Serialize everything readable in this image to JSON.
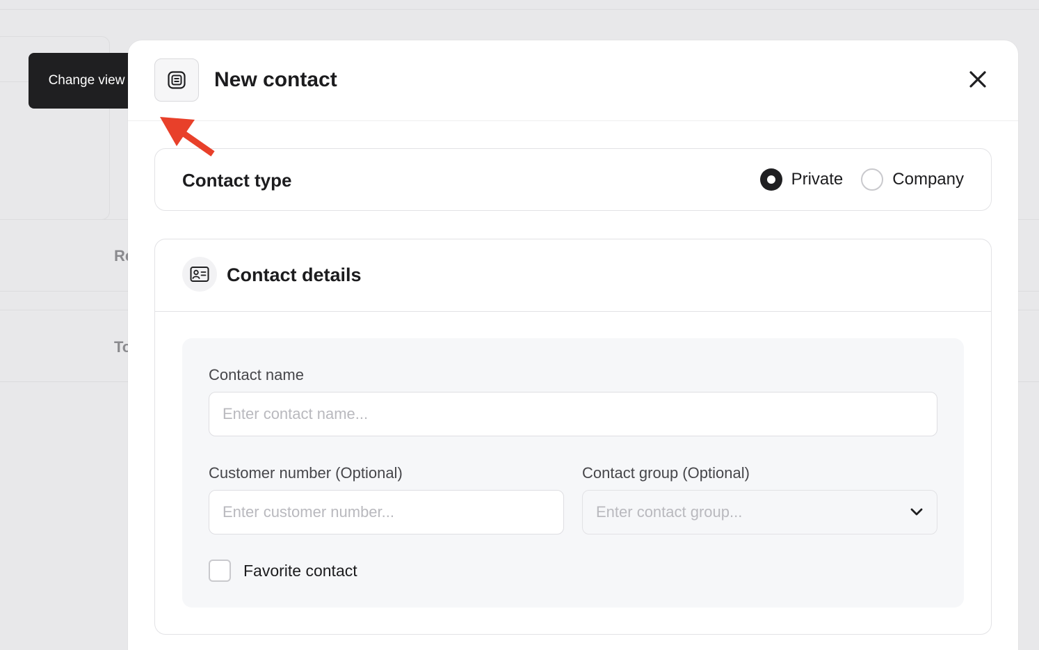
{
  "background": {
    "label_1": "Re",
    "label_2": "To"
  },
  "tooltip": {
    "text": "Change view"
  },
  "modal": {
    "title": "New contact",
    "view_button_icon": "list-view-icon",
    "close_icon": "close-icon"
  },
  "contact_type": {
    "title": "Contact type",
    "options": [
      {
        "label": "Private",
        "selected": true
      },
      {
        "label": "Company",
        "selected": false
      }
    ]
  },
  "contact_details": {
    "title": "Contact details",
    "icon": "id-card-icon",
    "fields": {
      "contact_name": {
        "label": "Contact name",
        "value": "",
        "placeholder": "Enter contact name..."
      },
      "customer_number": {
        "label": "Customer number (Optional)",
        "value": "",
        "placeholder": "Enter customer number..."
      },
      "contact_group": {
        "label": "Contact group (Optional)",
        "placeholder": "Enter contact group..."
      }
    },
    "favorite": {
      "label": "Favorite contact",
      "checked": false
    }
  },
  "colors": {
    "tooltip_bg": "#1f1f21",
    "annotation_arrow": "#e8402a",
    "radio_selected": "#1f1f21"
  }
}
